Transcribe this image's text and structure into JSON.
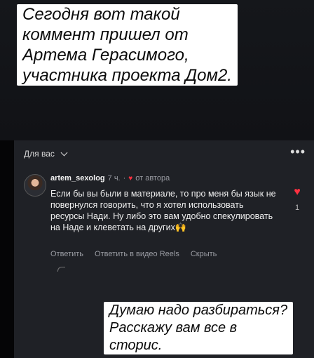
{
  "caption_top": {
    "lines": [
      "Сегодня вот такой",
      "коммент пришел от",
      "Артема Герасимого,",
      "участника проекта Дом2."
    ]
  },
  "caption_bottom": {
    "lines": [
      "Думаю надо разбираться?",
      "Расскажу вам все в",
      "сторис."
    ]
  },
  "feed": {
    "section_label": "Для вас",
    "more_icon": "more-horizontal-icon"
  },
  "comment": {
    "username": "artem_sexolog",
    "time": "7 ч.",
    "separator": "·",
    "author_badge": "от автора",
    "text": "Если бы вы были в материале, то про меня бы язык не повернулся говорить, что я хотел использовать ресурсы Нади. Ну либо это вам удобно спекулировать на Наде и клеветать на других",
    "emoji": "🙌",
    "actions": [
      "Ответить",
      "Ответить в видео Reels",
      "Скрыть"
    ],
    "like_count": "1",
    "like_color": "#ff3040"
  }
}
